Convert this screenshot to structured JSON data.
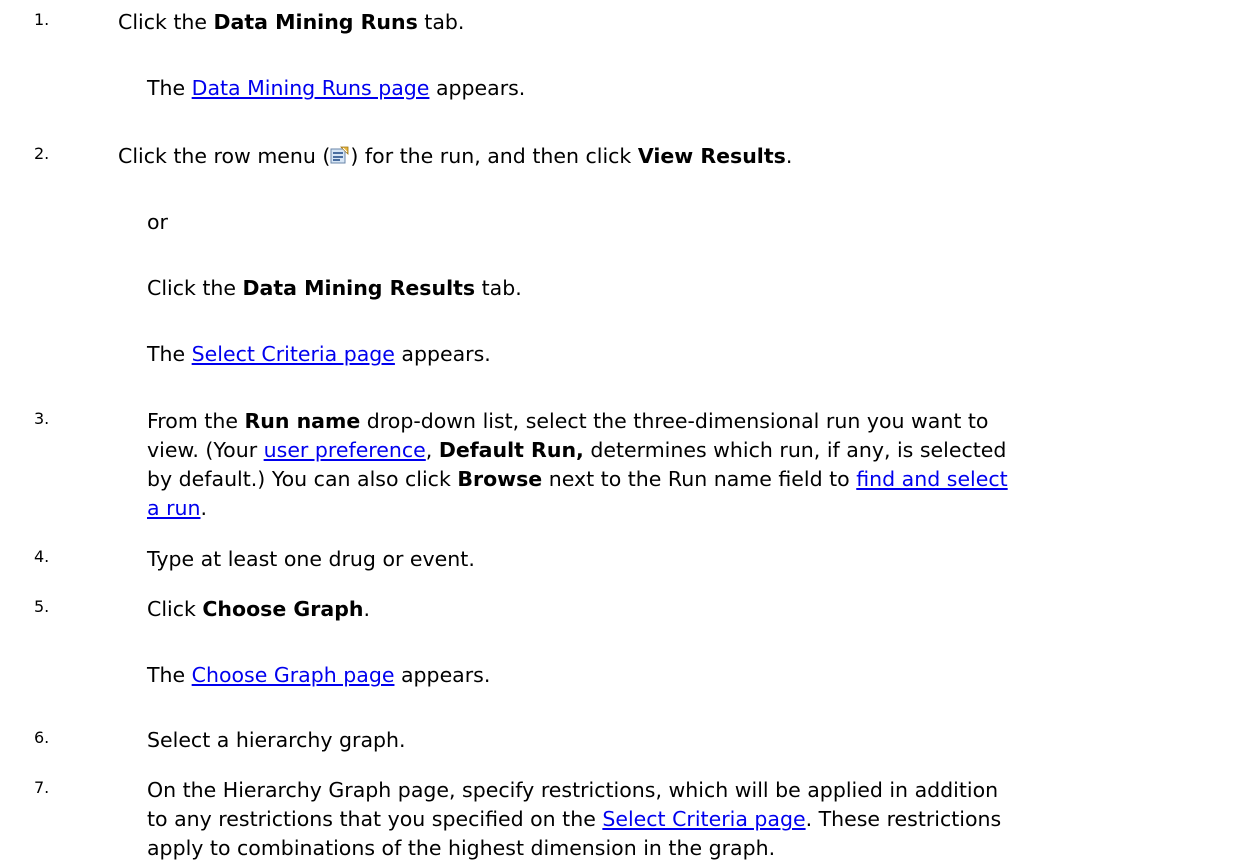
{
  "steps": [
    {
      "number": "1.",
      "text": [
        "Click the ",
        "Data Mining Runs",
        " tab."
      ],
      "result": [
        "The ",
        "Data Mining Runs page",
        " appears."
      ]
    },
    {
      "number": "2.",
      "text": [
        "Click the row menu (",
        ") for the run, and then click ",
        "View Results",
        "."
      ],
      "or": "or",
      "alt": [
        "Click the ",
        "Data Mining Results",
        " tab."
      ],
      "result": [
        "The ",
        "Select Criteria page",
        " appears."
      ]
    },
    {
      "number": "3.",
      "line1": [
        "From the ",
        "Run name",
        " drop-down list, select the three-dimensional run you want to"
      ],
      "line2": [
        "view. (Your ",
        "user preference",
        ", ",
        "Default Run,",
        " determines which run, if any, is selected"
      ],
      "line3": [
        "by default.) You can also click ",
        "Browse",
        " next to the Run name field to ",
        "find and select"
      ],
      "line4": [
        "a run",
        "."
      ]
    },
    {
      "number": "4.",
      "text": "Type at least one drug or event."
    },
    {
      "number": "5.",
      "text": [
        "Click ",
        "Choose Graph",
        "."
      ],
      "result": [
        "The ",
        "Choose Graph page",
        " appears."
      ]
    },
    {
      "number": "6.",
      "text": "Select a hierarchy graph."
    },
    {
      "number": "7.",
      "line1": "On the Hierarchy Graph page, specify restrictions, which will be applied in addition",
      "line2": [
        "to any restrictions that you specified on the ",
        "Select Criteria page",
        ". These restrictions"
      ],
      "line3": "apply to combinations of the highest dimension in the graph."
    }
  ],
  "icons": {
    "row_menu": "row-menu-icon"
  }
}
